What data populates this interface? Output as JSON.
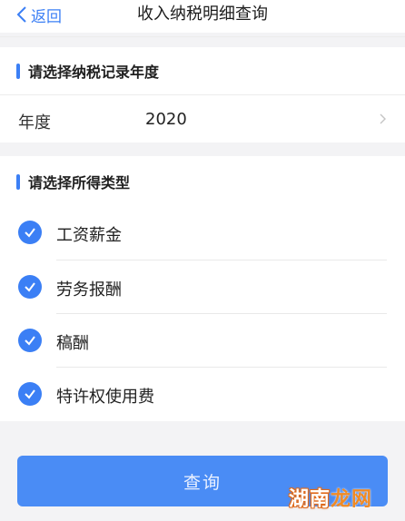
{
  "navbar": {
    "back_label": "返回",
    "title": "收入纳税明细查询"
  },
  "year_section": {
    "heading": "请选择纳税记录年度",
    "label": "年度",
    "value": "2020"
  },
  "type_section": {
    "heading": "请选择所得类型",
    "options": [
      {
        "label": "工资薪金",
        "checked": true
      },
      {
        "label": "劳务报酬",
        "checked": true
      },
      {
        "label": "稿酬",
        "checked": true
      },
      {
        "label": "特许权使用费",
        "checked": true
      }
    ]
  },
  "query_button": {
    "label": "查询"
  },
  "watermark": {
    "text_main": "湖南",
    "text_accent": "龙网"
  },
  "colors": {
    "accent": "#3b7ff5",
    "button": "#4a8cf5",
    "background": "#f3f3f5"
  }
}
